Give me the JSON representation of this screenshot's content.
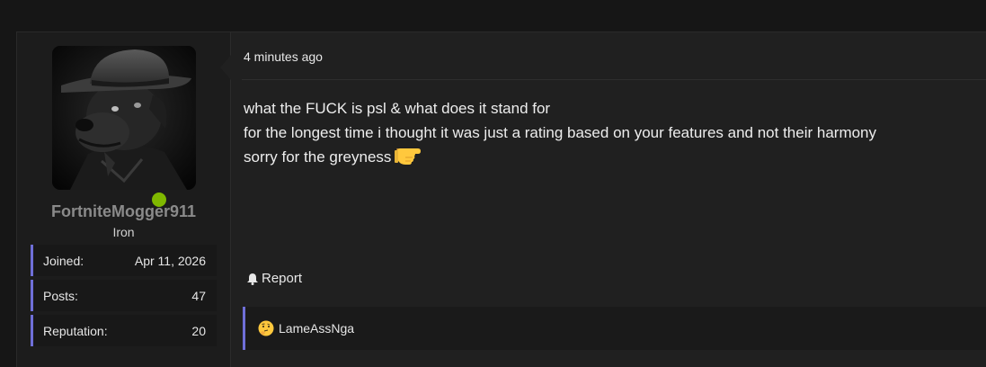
{
  "user": {
    "username": "FortniteMogger911",
    "rank": "Iron",
    "avatar_icon": "avatar-dog-in-fedora",
    "online_color": "#7fb800",
    "stats": [
      {
        "label": "Joined:",
        "value": "Apr 11, 2026"
      },
      {
        "label": "Posts:",
        "value": "47"
      },
      {
        "label": "Reputation:",
        "value": "20"
      }
    ]
  },
  "post": {
    "time": "4 minutes ago",
    "lines": [
      "what the FUCK is psl & what does it stand for",
      "for the longest time i thought it was just a rating based on your features and not their harmony",
      "sorry for the greyness"
    ],
    "trailing_emoji_icon": "backhand-index-pointing-right-icon"
  },
  "actions": {
    "report_label": "Report",
    "report_icon": "bell-icon"
  },
  "reactions": {
    "emoji_icon": "thinking-face-icon",
    "reactor": "LameAssNga"
  },
  "colors": {
    "accent": "#6f6fd8",
    "background": "#202020"
  }
}
